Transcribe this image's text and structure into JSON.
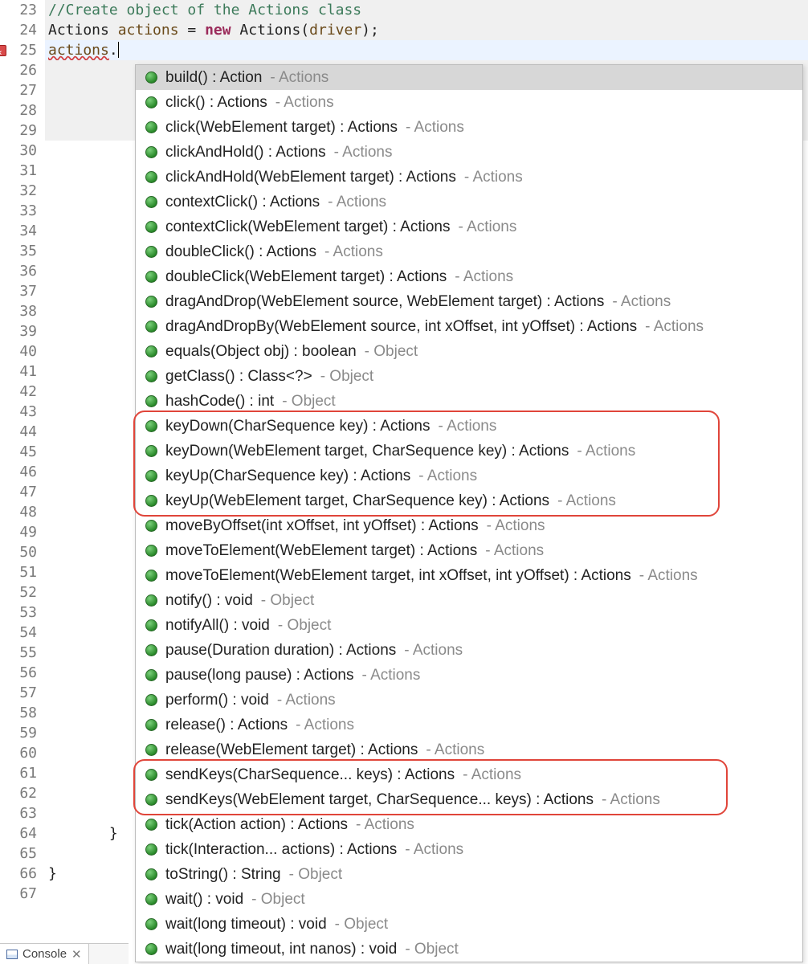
{
  "lines": {
    "start": 23,
    "end": 67,
    "error_line": 25,
    "shaded_through": 29
  },
  "code": {
    "comment": "//Create object of the Actions class",
    "l24_pre": "Actions ",
    "l24_var": "actions",
    "l24_eq": " = ",
    "l24_new": "new",
    "l24_post1": " Actions(",
    "l24_arg": "driver",
    "l24_post2": ");",
    "l25_var": "actions",
    "l25_dot": ".",
    "brace64": "       }",
    "brace66": "}"
  },
  "completions": [
    {
      "sig": "build() : Action",
      "origin": "Actions",
      "selected": true
    },
    {
      "sig": "click() : Actions",
      "origin": "Actions"
    },
    {
      "sig": "click(WebElement target) : Actions",
      "origin": "Actions"
    },
    {
      "sig": "clickAndHold() : Actions",
      "origin": "Actions"
    },
    {
      "sig": "clickAndHold(WebElement target) : Actions",
      "origin": "Actions"
    },
    {
      "sig": "contextClick() : Actions",
      "origin": "Actions"
    },
    {
      "sig": "contextClick(WebElement target) : Actions",
      "origin": "Actions"
    },
    {
      "sig": "doubleClick() : Actions",
      "origin": "Actions"
    },
    {
      "sig": "doubleClick(WebElement target) : Actions",
      "origin": "Actions"
    },
    {
      "sig": "dragAndDrop(WebElement source, WebElement target) : Actions",
      "origin": "Actions"
    },
    {
      "sig": "dragAndDropBy(WebElement source, int xOffset, int yOffset) : Actions",
      "origin": "Actions"
    },
    {
      "sig": "equals(Object obj) : boolean",
      "origin": "Object"
    },
    {
      "sig": "getClass() : Class<?>",
      "origin": "Object"
    },
    {
      "sig": "hashCode() : int",
      "origin": "Object"
    },
    {
      "sig": "keyDown(CharSequence key) : Actions",
      "origin": "Actions"
    },
    {
      "sig": "keyDown(WebElement target, CharSequence key) : Actions",
      "origin": "Actions"
    },
    {
      "sig": "keyUp(CharSequence key) : Actions",
      "origin": "Actions"
    },
    {
      "sig": "keyUp(WebElement target, CharSequence key) : Actions",
      "origin": "Actions"
    },
    {
      "sig": "moveByOffset(int xOffset, int yOffset) : Actions",
      "origin": "Actions"
    },
    {
      "sig": "moveToElement(WebElement target) : Actions",
      "origin": "Actions"
    },
    {
      "sig": "moveToElement(WebElement target, int xOffset, int yOffset) : Actions",
      "origin": "Actions"
    },
    {
      "sig": "notify() : void",
      "origin": "Object"
    },
    {
      "sig": "notifyAll() : void",
      "origin": "Object"
    },
    {
      "sig": "pause(Duration duration) : Actions",
      "origin": "Actions"
    },
    {
      "sig": "pause(long pause) : Actions",
      "origin": "Actions"
    },
    {
      "sig": "perform() : void",
      "origin": "Actions"
    },
    {
      "sig": "release() : Actions",
      "origin": "Actions"
    },
    {
      "sig": "release(WebElement target) : Actions",
      "origin": "Actions"
    },
    {
      "sig": "sendKeys(CharSequence... keys) : Actions",
      "origin": "Actions"
    },
    {
      "sig": "sendKeys(WebElement target, CharSequence... keys) : Actions",
      "origin": "Actions"
    },
    {
      "sig": "tick(Action action) : Actions",
      "origin": "Actions"
    },
    {
      "sig": "tick(Interaction... actions) : Actions",
      "origin": "Actions"
    },
    {
      "sig": "toString() : String",
      "origin": "Object"
    },
    {
      "sig": "wait() : void",
      "origin": "Object"
    },
    {
      "sig": "wait(long timeout) : void",
      "origin": "Object"
    },
    {
      "sig": "wait(long timeout, int nanos) : void",
      "origin": "Object"
    }
  ],
  "annotations": [
    {
      "covers": [
        14,
        15,
        16,
        17
      ]
    },
    {
      "covers": [
        28,
        29
      ]
    }
  ],
  "bottom": {
    "console_label": "Console"
  }
}
